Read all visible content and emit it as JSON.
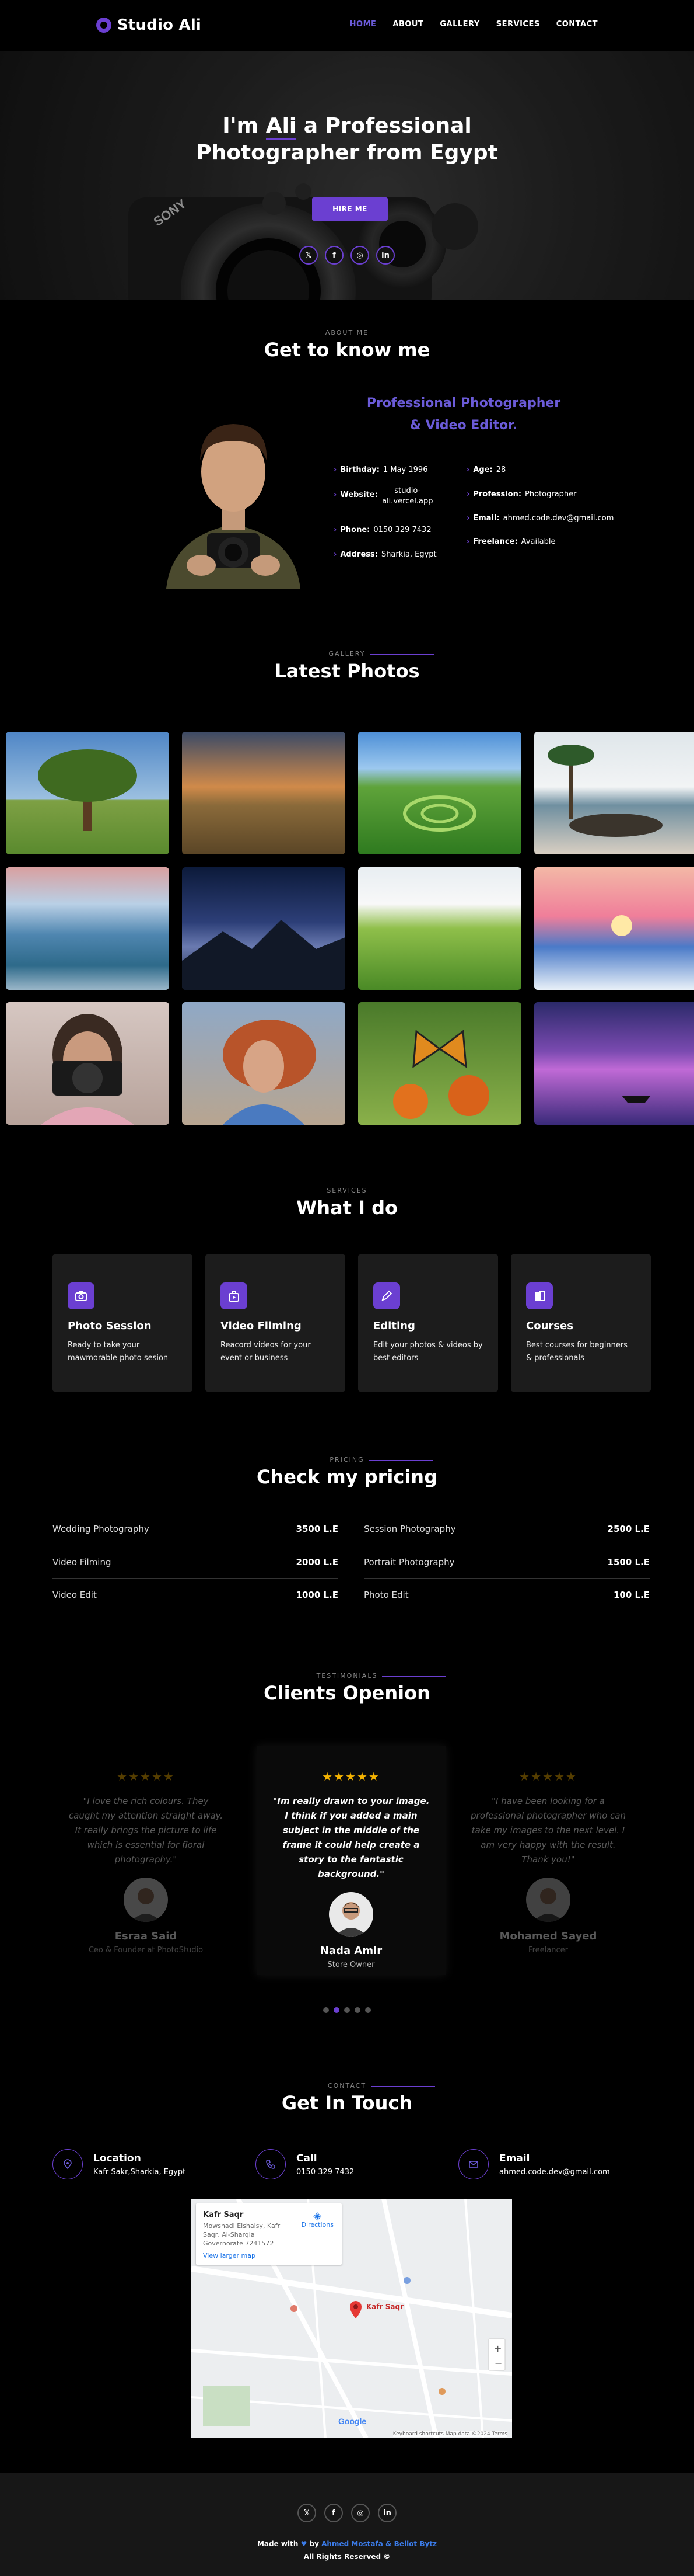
{
  "brand": {
    "name": "Studio Ali"
  },
  "nav": [
    "HOME",
    "ABOUT",
    "GALLERY",
    "SERVICES",
    "CONTACT"
  ],
  "hero": {
    "line1_pre": "I'm ",
    "line1_name": "Ali",
    "line1_post": " a Professional",
    "line2": "Photographer from Egypt",
    "button": "HIRE ME",
    "social": [
      "𝕏",
      "f",
      "◎",
      "in"
    ]
  },
  "about": {
    "label": "ABOUT ME",
    "title": "Get to know me",
    "subtitle_1": "Professional Photographer",
    "subtitle_2": "& Video Editor.",
    "fields": [
      {
        "k": "Birthday:",
        "v": "1 May 1996"
      },
      {
        "k": "Website:",
        "v": "studio-ali.vercel.app"
      },
      {
        "k": "Phone:",
        "v": "0150 329 7432"
      },
      {
        "k": "Address:",
        "v": "Sharkia, Egypt"
      },
      {
        "k": "Age:",
        "v": "28"
      },
      {
        "k": "Profession:",
        "v": "Photographer"
      },
      {
        "k": "Email:",
        "v": "ahmed.code.dev@gmail.com"
      },
      {
        "k": "Freelance:",
        "v": "Available"
      }
    ]
  },
  "gallery": {
    "label": "GALLERY",
    "title": "Latest Photos"
  },
  "services": {
    "label": "SERVICES",
    "title": "What I do",
    "items": [
      {
        "title": "Photo Session",
        "desc": "Ready to take your mawmorable photo sesion",
        "icon": "camera-icon"
      },
      {
        "title": "Video Filming",
        "desc": "Reacord videos for your event or business",
        "icon": "video-bag-icon"
      },
      {
        "title": "Editing",
        "desc": "Edit your photos & videos by best editors",
        "icon": "pen-icon"
      },
      {
        "title": "Courses",
        "desc": "Best courses for beginners & professionals",
        "icon": "book-icon"
      }
    ]
  },
  "pricing": {
    "label": "PRICING",
    "title": "Check my pricing",
    "left": [
      {
        "name": "Wedding Photography",
        "price": "3500 L.E"
      },
      {
        "name": "Video Filming",
        "price": "2000 L.E"
      },
      {
        "name": "Video Edit",
        "price": "1000 L.E"
      }
    ],
    "right": [
      {
        "name": "Session Photography",
        "price": "2500 L.E"
      },
      {
        "name": "Portrait Photography",
        "price": "1500 L.E"
      },
      {
        "name": "Photo Edit",
        "price": "100 L.E"
      }
    ]
  },
  "testimonials": {
    "label": "TESTIMONIALS",
    "title": "Clients Openion",
    "stars": "★★★★★",
    "items": [
      {
        "quote": "\"I love the rich colours. They caught my attention straight away. It really brings the picture to life which is essential for floral photography.\"",
        "name": "Esraa Said",
        "role": "Ceo & Founder at PhotoStudio"
      },
      {
        "quote": "\"Im really drawn to your image. I think if you added a main subject in the middle of the frame it could help create a story to the fantastic background.\"",
        "name": "Nada Amir",
        "role": "Store Owner"
      },
      {
        "quote": "\"I have been looking for a professional photographer who can take my images to the next level. I am very happy with the result. Thank you!\"",
        "name": "Mohamed Sayed",
        "role": "Freelancer"
      }
    ]
  },
  "contact": {
    "label": "CONTACT",
    "title": "Get In Touch",
    "location_title": "Location",
    "location": "Kafr Sakr,Sharkia, Egypt",
    "call_title": "Call",
    "call": "0150 329 7432",
    "email_title": "Email",
    "email": "ahmed.code.dev@gmail.com",
    "map": {
      "place": "Kafr Saqr",
      "address": "Mowshadi Elshalsy, Kafr Saqr, Al-Sharqia Governorate 7241572",
      "larger": "View larger map",
      "directions": "Directions",
      "pin": "Kafr Saqr",
      "footer": "Keyboard shortcuts   Map data ©2024   Terms"
    }
  },
  "footer": {
    "made_pre": "Made with ",
    "made_by": " by ",
    "made_author": "Ahmed Mostafa",
    "made_amp": " & ",
    "made_author2": "Bellot Bytz",
    "rights": "All Rights Reserved ©"
  },
  "colors": {
    "accent": "#6b3fd1",
    "link": "#6b5bd8",
    "star": "#f5b301"
  }
}
